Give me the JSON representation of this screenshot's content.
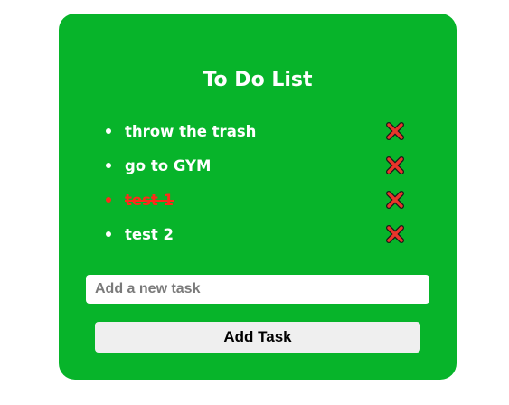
{
  "app": {
    "title": "To Do List"
  },
  "tasks": [
    {
      "text": "throw the trash",
      "completed": false
    },
    {
      "text": "go to GYM",
      "completed": false
    },
    {
      "text": "test 1",
      "completed": true
    },
    {
      "text": "test 2",
      "completed": false
    }
  ],
  "input": {
    "value": "",
    "placeholder": "Add a new task"
  },
  "add_button": {
    "label": "Add Task"
  },
  "icons": {
    "delete": "close-x-icon"
  },
  "colors": {
    "card_background": "#07b42a",
    "text": "#ffffff",
    "completed_text": "#ff2a1a",
    "delete_icon": "#e8352b",
    "button_background": "#efefef"
  }
}
